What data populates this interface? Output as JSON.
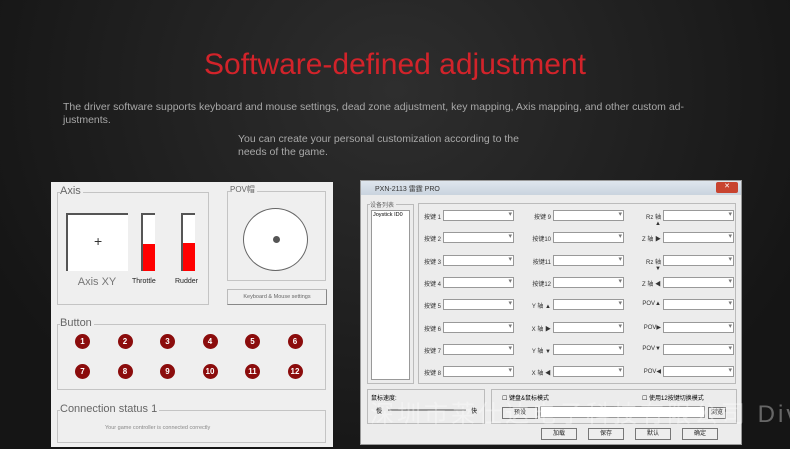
{
  "title": "Software-defined adjustment",
  "desc1": "The driver software supports keyboard and mouse settings, dead zone adjustment, key mapping, Axis mapping, and other custom ad-justments.",
  "desc2": "You can create your personal customization according to the needs of the game.",
  "left_panel": {
    "axis_label": "Axis",
    "axis_xy": "Axis XY",
    "throttle": "Throttle",
    "rudder": "Rudder",
    "throttle_level": 0.48,
    "rudder_level": 0.5,
    "pov_label": "POV帽",
    "km_button": "Keyboard & Mouse settings",
    "button_label": "Button",
    "buttons": [
      "1",
      "2",
      "3",
      "4",
      "5",
      "6",
      "7",
      "8",
      "9",
      "10",
      "11",
      "12"
    ],
    "conn_label": "Connection status 1",
    "conn_text": "Your game controller is connected correctly"
  },
  "right_window": {
    "title": "PXN-2113 雷霆 PRO",
    "close": "✕",
    "device_list_label": "设备列表",
    "device": "Joystick ID0",
    "col1": [
      "按键 1",
      "按键 2",
      "按键 3",
      "按键 4",
      "按键 5",
      "按键 6",
      "按键 7",
      "按键 8"
    ],
    "col2": [
      "按键 9",
      "按键10",
      "按键11",
      "按键12",
      "Y 轴 ▲",
      "X 轴 ▶",
      "Y 轴 ▼",
      "X 轴 ◀"
    ],
    "col3": [
      "Rz 轴 ▲",
      "Z 轴 ▶",
      "Rz 轴 ▼",
      "Z 轴 ◀",
      "POV▲",
      "POV▶",
      "POV▼",
      "POV◀"
    ],
    "mouse_speed": "鼠标速度:",
    "slow": "慢",
    "fast": "快",
    "km_mode": "键盘&鼠标模式",
    "mode12": "使用12按键切换模式",
    "preset": "预设",
    "browse": "浏览",
    "buttons": [
      "加载",
      "保存",
      "默认",
      "确定"
    ]
  },
  "watermark": "深圳市莱仕达电子科技有限公司 Division"
}
